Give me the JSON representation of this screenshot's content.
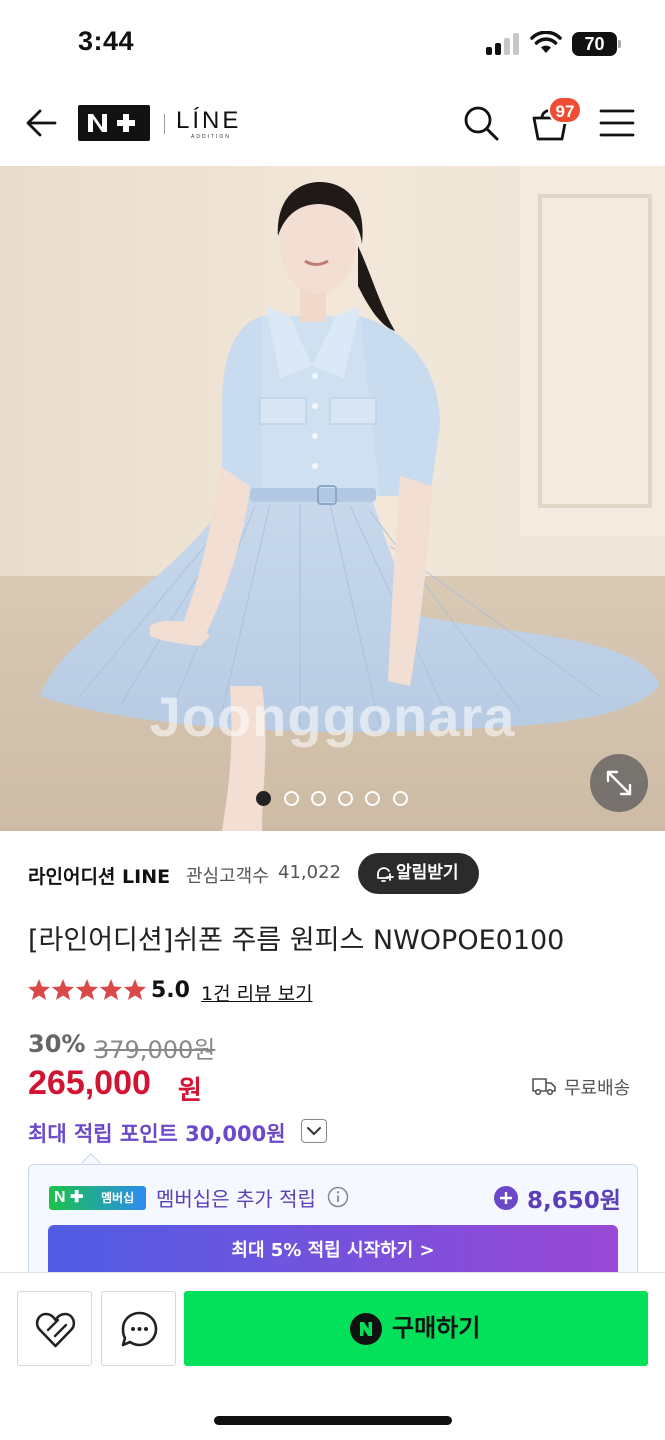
{
  "status_bar": {
    "time": "3:44",
    "battery": "70"
  },
  "header": {
    "brand_mark": "N+",
    "line_logo": "LÍNE",
    "line_logo_sub": "ADDITION",
    "cart_count": "97"
  },
  "gallery": {
    "watermark": "Joonggonara",
    "image_count": 6,
    "active_index": 0
  },
  "store": {
    "name": "라인어디션 LINE",
    "follower_label": "관심고객수",
    "follower_count": "41,022",
    "notify_label": "알림받기"
  },
  "product": {
    "title": "[라인어디션]쉬폰 주름 원피스 NWOPOE0100",
    "rating": "5.0",
    "rating_stars": 5,
    "review_link": "1건 리뷰 보기",
    "discount_rate": "30%",
    "original_price": "379,000원",
    "sale_price": "265,000",
    "price_unit": "원",
    "shipping": "무료배송",
    "points_label": "최대 적립 포인트 30,000원"
  },
  "membership": {
    "badge_label": "멤버십",
    "text": "멤버십은 추가 적립",
    "points": "8,650원",
    "cta": "최대 5% 적립 시작하기 >"
  },
  "bottom_bar": {
    "buy_label": "구매하기"
  },
  "colors": {
    "sale_red": "#d11432",
    "purple": "#6b49c8",
    "buy_green": "#03e05a",
    "badge_red": "#ef4b35"
  }
}
